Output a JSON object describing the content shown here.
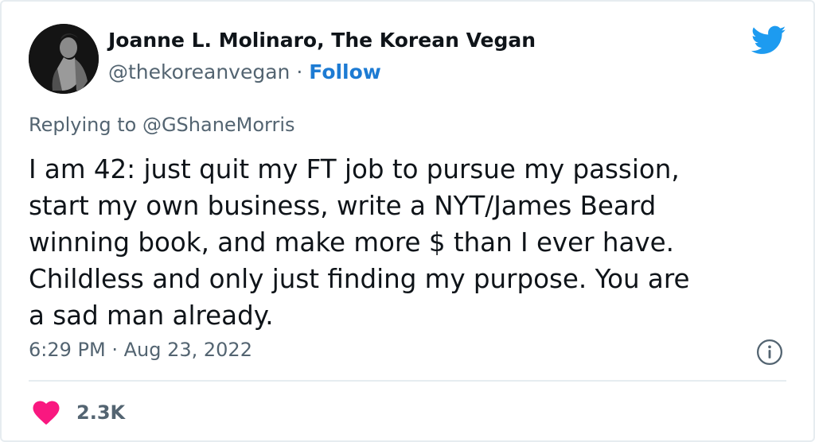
{
  "author": {
    "display_name": "Joanne L. Molinaro, The Korean Vegan",
    "handle": "@thekoreanvegan",
    "separator": " · ",
    "follow_label": "Follow"
  },
  "reply": {
    "prefix": "Replying to ",
    "target": "@GShaneMorris"
  },
  "tweet": {
    "lines": [
      "I am 42: just quit my FT job to pursue my passion,",
      "start my own business, write a NYT/James Beard",
      "winning book, and make more $ than I ever have.",
      "Childless and only just finding my purpose. You are",
      "a sad man already."
    ]
  },
  "meta": {
    "timestamp": "6:29 PM · Aug 23, 2022"
  },
  "engagement": {
    "likes": "2.3K"
  },
  "icons": {
    "brand": "twitter-bird-icon",
    "info": "info-icon",
    "like": "heart-icon"
  },
  "colors": {
    "brand_blue": "#1d9bf0",
    "link_blue": "#1d7bd3",
    "like_pink": "#f91880",
    "muted_text": "#536471",
    "primary_text": "#0f1419",
    "divider": "#e6ecf0"
  }
}
